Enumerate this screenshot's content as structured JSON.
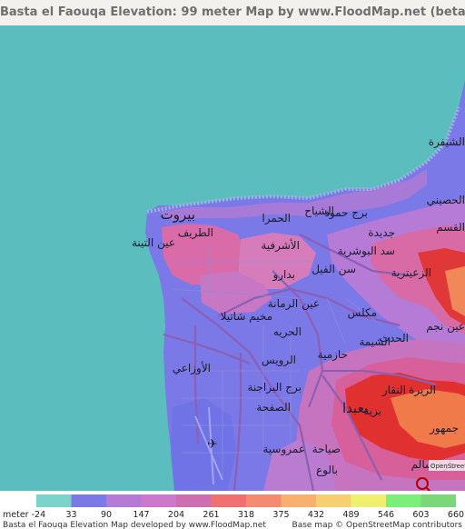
{
  "title": "Basta el Faouqa Elevation: 99 meter Map by www.FloodMap.net (beta)",
  "colors": {
    "sea": "#5bbdbd",
    "low": "#7b78e8",
    "mid": "#9a7ae0",
    "pink": "#d96ca8",
    "red": "#e03535",
    "orange": "#f08050",
    "road": "#8c5fb2",
    "street": "#8f8bd6"
  },
  "map": {
    "labels": [
      {
        "text": "بيروت",
        "big": true
      },
      {
        "text": "الحمرا"
      },
      {
        "text": "الطريف"
      },
      {
        "text": "عين التينة"
      },
      {
        "text": "الأشرفية"
      },
      {
        "text": "برج حمود"
      },
      {
        "text": "الشياح"
      },
      {
        "text": "جديدة"
      },
      {
        "text": "سد البوشرية"
      },
      {
        "text": "سن الفيل"
      },
      {
        "text": "الزعيترية"
      },
      {
        "text": "بدارو"
      },
      {
        "text": "عين الرمانة"
      },
      {
        "text": "مخيم شاتيلا"
      },
      {
        "text": "الحريه"
      },
      {
        "text": "مكلس"
      },
      {
        "text": "الشيمة"
      },
      {
        "text": "حازمية"
      },
      {
        "text": "الرويس"
      },
      {
        "text": "الأوزاعي"
      },
      {
        "text": "برج البراجنة"
      },
      {
        "text": "الصفحة"
      },
      {
        "text": "بعبدا"
      },
      {
        "text": "الحدث"
      },
      {
        "text": "بزية"
      },
      {
        "text": "النقار"
      },
      {
        "text": "الزيرة"
      },
      {
        "text": "جمهور"
      },
      {
        "text": "عمروسية"
      },
      {
        "text": "صياحة"
      },
      {
        "text": "بالوع"
      },
      {
        "text": "حارة سالم"
      },
      {
        "text": "الحصيني"
      },
      {
        "text": "عين نجم"
      },
      {
        "text": "القسم"
      },
      {
        "text": "الشيفرة"
      }
    ],
    "watermark": "OpenStreetMap"
  },
  "legend": {
    "unit": "meter",
    "values": [
      "-24",
      "33",
      "90",
      "147",
      "204",
      "261",
      "318",
      "375",
      "432",
      "489",
      "546",
      "603",
      "660"
    ],
    "colors": [
      "#7bd3c9",
      "#7b78e8",
      "#b57ad6",
      "#cc79cc",
      "#cc6eb0",
      "#f07070",
      "#f48a70",
      "#f7b070",
      "#f5d070",
      "#f0f070",
      "#7af07a",
      "#7ad87a"
    ],
    "footer_left": "Basta el Faouqa Elevation Map developed by www.FloodMap.net",
    "footer_right": "Base map © OpenStreetMap contributors"
  }
}
